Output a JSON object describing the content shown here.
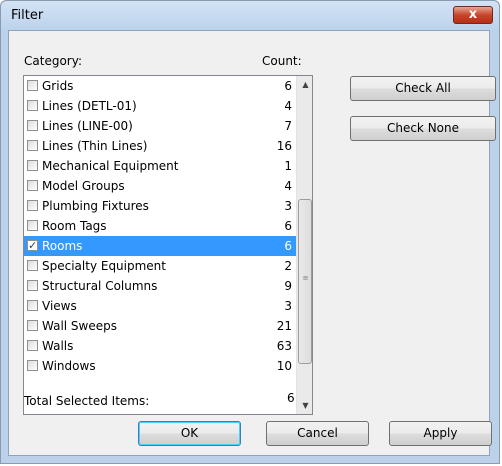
{
  "window": {
    "title": "Filter",
    "close_label": "x"
  },
  "labels": {
    "category": "Category:",
    "count": "Count:",
    "total": "Total Selected Items:",
    "total_value": "6"
  },
  "items": [
    {
      "name": "Grids",
      "count": "6",
      "checked": false,
      "selected": false
    },
    {
      "name": "Lines (DETL-01)",
      "count": "4",
      "checked": false,
      "selected": false
    },
    {
      "name": "Lines (LINE-00)",
      "count": "7",
      "checked": false,
      "selected": false
    },
    {
      "name": "Lines (Thin Lines)",
      "count": "16",
      "checked": false,
      "selected": false
    },
    {
      "name": "Mechanical Equipment",
      "count": "1",
      "checked": false,
      "selected": false
    },
    {
      "name": "Model Groups",
      "count": "4",
      "checked": false,
      "selected": false
    },
    {
      "name": "Plumbing Fixtures",
      "count": "3",
      "checked": false,
      "selected": false
    },
    {
      "name": "Room Tags",
      "count": "6",
      "checked": false,
      "selected": false
    },
    {
      "name": "Rooms",
      "count": "6",
      "checked": true,
      "selected": true
    },
    {
      "name": "Specialty Equipment",
      "count": "2",
      "checked": false,
      "selected": false
    },
    {
      "name": "Structural Columns",
      "count": "9",
      "checked": false,
      "selected": false
    },
    {
      "name": "Views",
      "count": "3",
      "checked": false,
      "selected": false
    },
    {
      "name": "Wall Sweeps",
      "count": "21",
      "checked": false,
      "selected": false
    },
    {
      "name": "Walls",
      "count": "63",
      "checked": false,
      "selected": false
    },
    {
      "name": "Windows",
      "count": "10",
      "checked": false,
      "selected": false
    }
  ],
  "buttons": {
    "check_all": "Check All",
    "check_none": "Check None",
    "ok": "OK",
    "cancel": "Cancel",
    "apply": "Apply"
  },
  "colors": {
    "selection": "#3399ff",
    "titlebar": "#bcd3ec",
    "close": "#c7452c"
  }
}
